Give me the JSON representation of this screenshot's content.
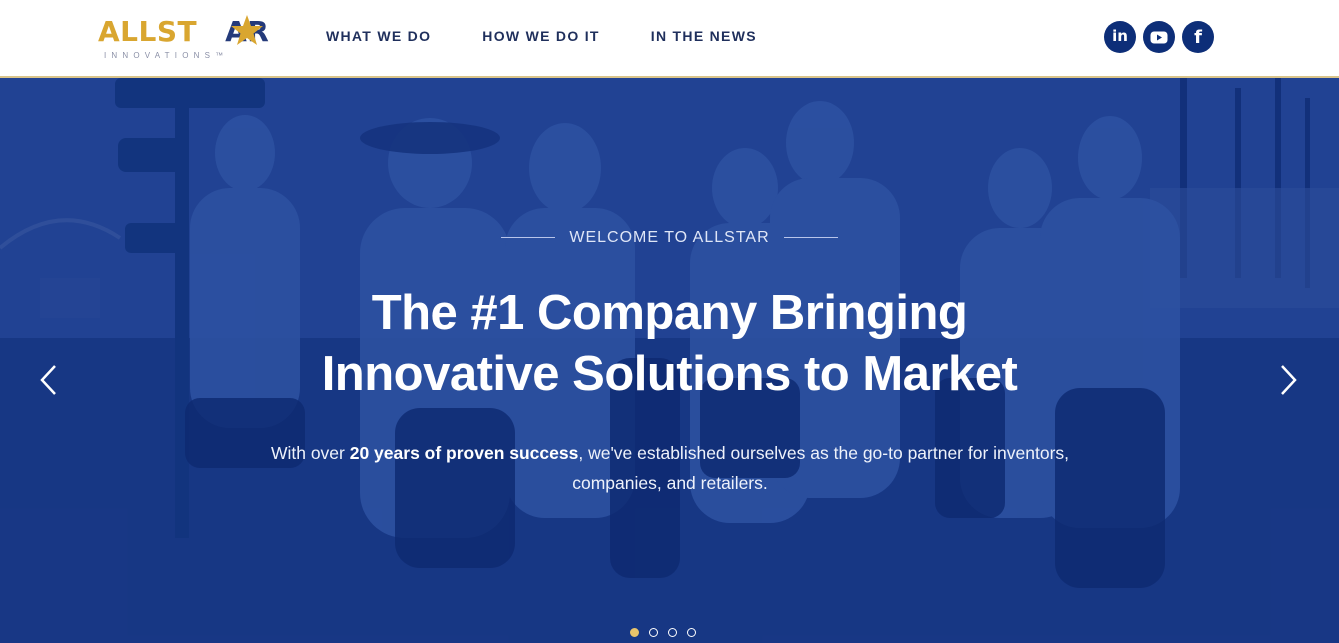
{
  "brand": {
    "logo_part1": "ALLST",
    "logo_part2": "AR",
    "logo_subtitle": "INNOVATIONS™",
    "gold": "#d9a630",
    "navy": "#243a7a"
  },
  "nav": {
    "items": [
      {
        "label": "WHAT WE DO"
      },
      {
        "label": "HOW WE DO IT"
      },
      {
        "label": "IN THE NEWS"
      }
    ]
  },
  "social": {
    "icons": [
      "linkedin-icon",
      "youtube-icon",
      "facebook-icon"
    ],
    "linkedin_text": "in",
    "facebook_text": "f"
  },
  "hero": {
    "eyebrow": "WELCOME TO ALLSTAR",
    "headline_line1": "The #1 Company Bringing",
    "headline_line2": "Innovative Solutions to Market",
    "sub_before": "With over ",
    "sub_bold": "20 years of proven success",
    "sub_after": ", we've established ourselves as the go-to partner for inventors, companies, and retailers.",
    "prev_icon": "chevron-left-icon",
    "next_icon": "chevron-right-icon",
    "slide_count": 4,
    "active_slide": 1
  },
  "colors": {
    "hero_blue": "#1d3f8e",
    "active_dot": "#e8c46b"
  }
}
